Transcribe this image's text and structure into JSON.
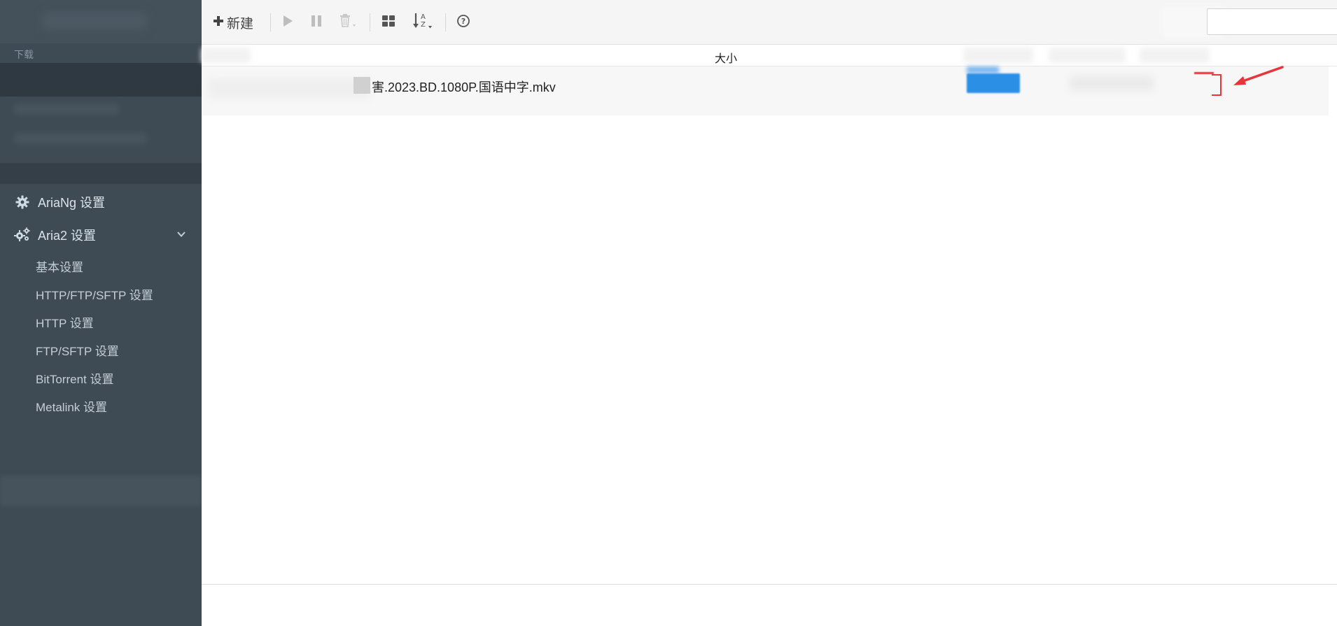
{
  "sidebar": {
    "section_label": "下载",
    "items": [
      {
        "label": "AriaNg 设置",
        "icon": "gear-icon"
      },
      {
        "label": "Aria2 设置",
        "icon": "gears-icon",
        "expanded": true
      }
    ],
    "subitems": [
      "基本设置",
      "HTTP/FTP/SFTP 设置",
      "HTTP 设置",
      "FTP/SFTP 设置",
      "BitTorrent 设置",
      "Metalink 设置"
    ]
  },
  "toolbar": {
    "new_label": "新建",
    "icons": [
      "plus-icon",
      "play-icon",
      "pause-icon",
      "trash-icon",
      "grid-icon",
      "sort-az-icon",
      "help-icon"
    ]
  },
  "search": {
    "value": "",
    "placeholder": ""
  },
  "table": {
    "columns": [
      "大小"
    ],
    "rows": [
      {
        "name": "害.2023.BD.1080P.国语中字.mkv"
      }
    ]
  },
  "colors": {
    "sidebar_bg": "#3e4a54",
    "toolbar_bg": "#f5f5f5",
    "progress": "#2b8fe6",
    "annotation": "#e8343b"
  }
}
